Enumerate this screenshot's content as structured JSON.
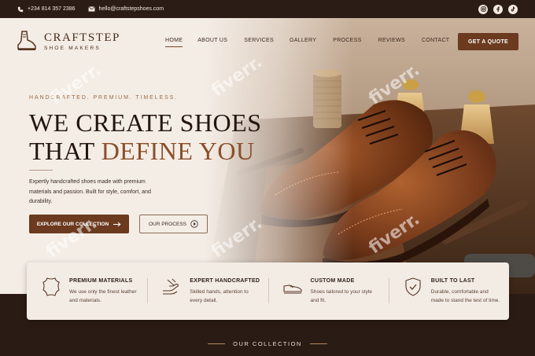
{
  "topbar": {
    "phone": "+234 814 357 2386",
    "email": "hello@craftstepshoes.com",
    "socials": [
      "instagram-icon",
      "facebook-icon",
      "tiktok-icon"
    ]
  },
  "brand": {
    "name": "CRAFTSTEP",
    "tagline": "SHOE MAKERS"
  },
  "nav": {
    "items": [
      {
        "label": "HOME",
        "active": true
      },
      {
        "label": "ABOUT US"
      },
      {
        "label": "SERVICES"
      },
      {
        "label": "GALLERY"
      },
      {
        "label": "PROCESS"
      },
      {
        "label": "REVIEWS"
      },
      {
        "label": "CONTACT"
      }
    ],
    "cta_label": "GET A QUOTE"
  },
  "hero": {
    "eyebrow": "HANDCRAFTED. PREMIUM. TIMELESS.",
    "headline_line1": "WE CREATE SHOES",
    "headline_line2_plain": "THAT ",
    "headline_line2_accent": "DEFINE YOU",
    "description": "Expertly handcrafted shoes made with premium materials and passion. Built for style, comfort, and durability.",
    "primary_button": "EXPLORE OUR COLLECTION",
    "secondary_button": "OUR PROCESS"
  },
  "features": [
    {
      "icon": "leather-hide-icon",
      "title": "PREMIUM MATERIALS",
      "desc": "We use only the finest leather and materials."
    },
    {
      "icon": "hand-craft-icon",
      "title": "EXPERT HANDCRAFTED",
      "desc": "Skilled hands, attention to every detail."
    },
    {
      "icon": "shoe-icon",
      "title": "CUSTOM MADE",
      "desc": "Shoes tailored to your style and fit."
    },
    {
      "icon": "shield-check-icon",
      "title": "BUILT TO LAST",
      "desc": "Durable, comfortable and made to stand the test of time."
    }
  ],
  "collection": {
    "title": "OUR COLLECTION"
  },
  "watermark": "fiverr.",
  "colors": {
    "brand_brown": "#6b3a1f",
    "accent_brown": "#8a4f2a",
    "dark_bg": "#2a1c14",
    "cream": "#f4ede6"
  }
}
